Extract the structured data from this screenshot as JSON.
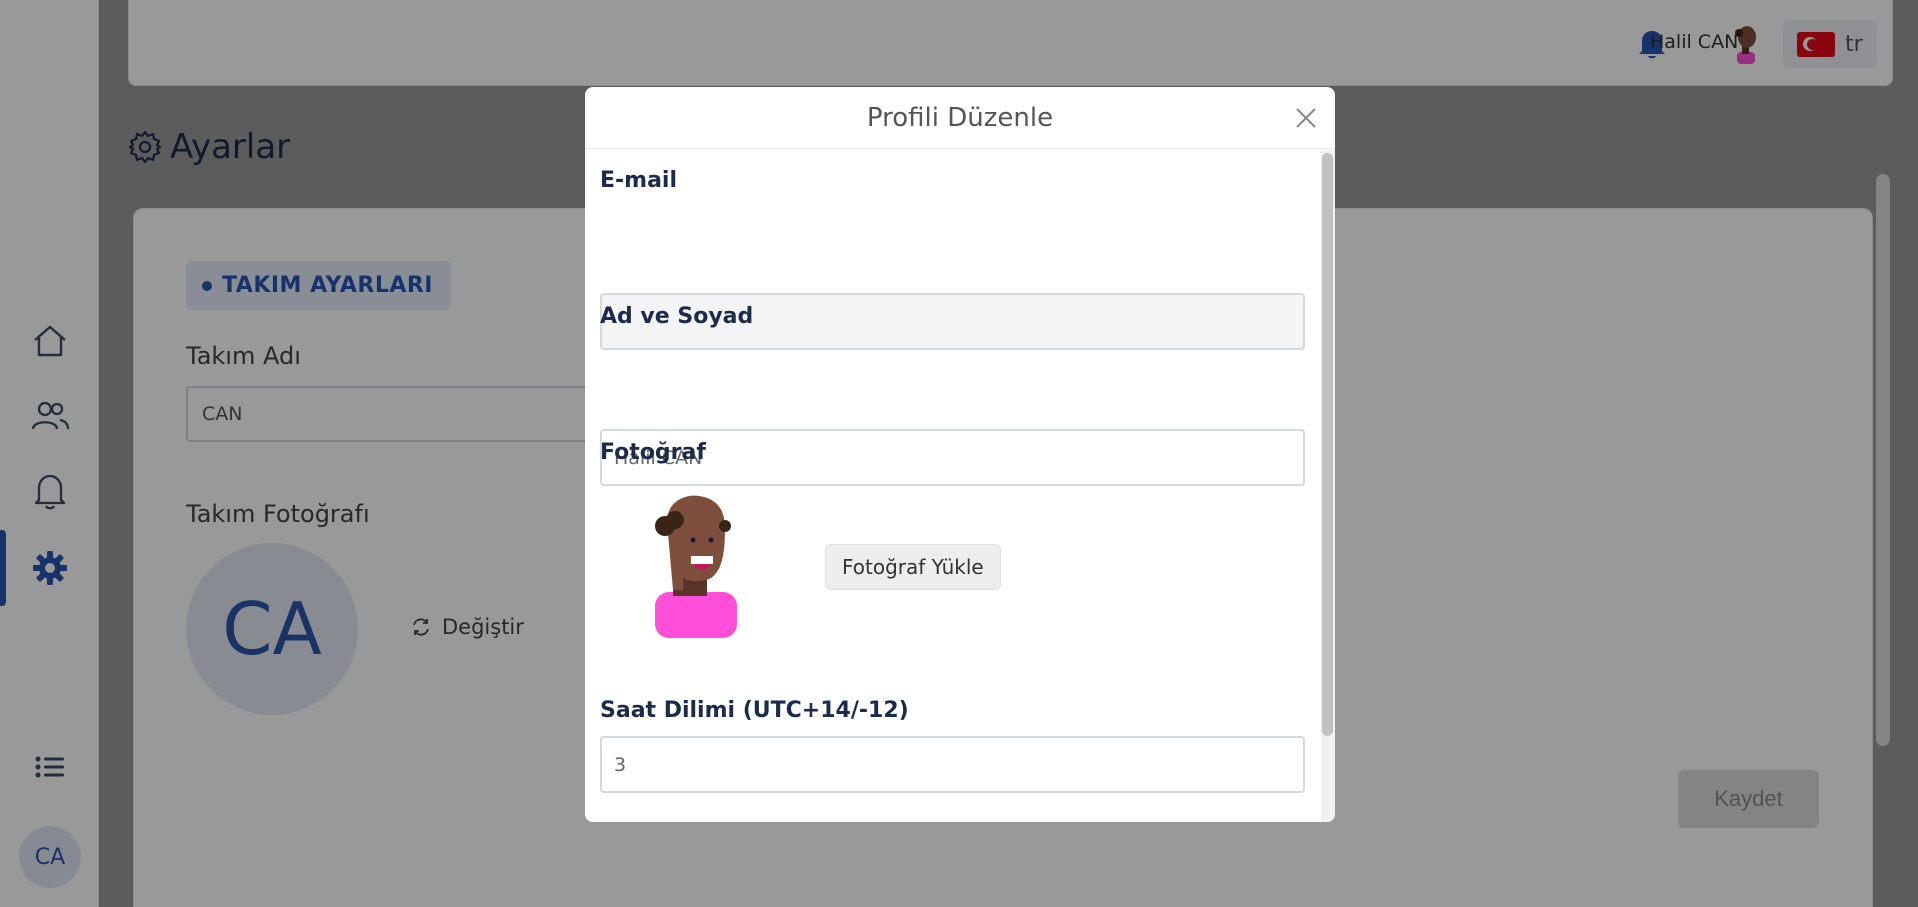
{
  "topbar": {
    "user_name": "Halil CAN",
    "language": "tr"
  },
  "page": {
    "title": "Ayarlar"
  },
  "team_settings": {
    "section_label": "TAKIM AYARLARI",
    "team_name_label": "Takım Adı",
    "team_name_value": "CAN",
    "team_photo_label": "Takım Fotoğrafı",
    "team_avatar_initials": "CA",
    "change_label": "Değiştir",
    "save_label": "Kaydet"
  },
  "sidebar": {
    "items": [
      {
        "icon": "home-icon"
      },
      {
        "icon": "users-icon"
      },
      {
        "icon": "bell-icon"
      },
      {
        "icon": "gear-icon",
        "active": true
      },
      {
        "icon": "list-icon"
      }
    ],
    "user_initials": "CA"
  },
  "modal": {
    "title": "Profili Düzenle",
    "email_label": "E-mail",
    "email_value": "",
    "name_label": "Ad ve Soyad",
    "name_value": "Halil CAN",
    "photo_label": "Fotoğraf",
    "upload_label": "Fotoğraf Yükle",
    "timezone_label": "Saat Dilimi (UTC+14/-12)",
    "timezone_value": "3"
  },
  "colors": {
    "accent": "#2855b5",
    "avatar_shirt": "#ff4fd8",
    "avatar_skin": "#7d4f3c"
  }
}
